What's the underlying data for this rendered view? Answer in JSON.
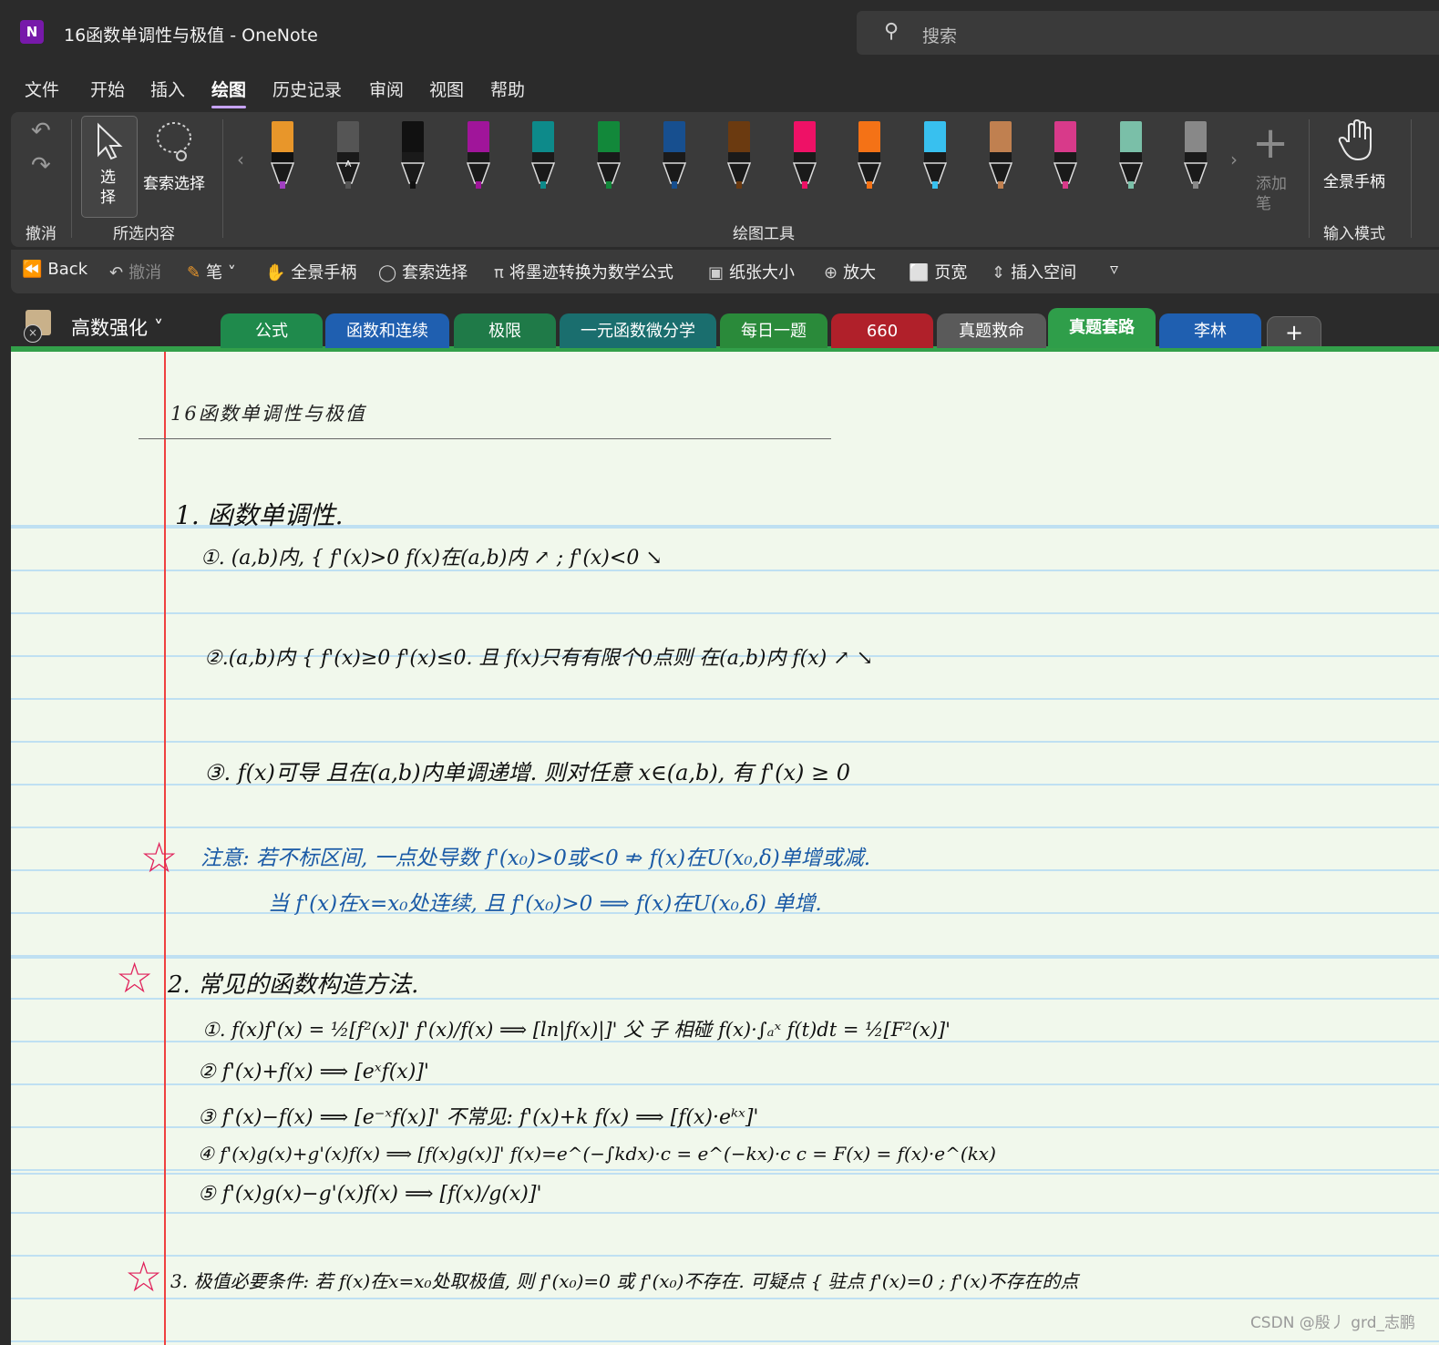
{
  "window": {
    "app_icon_letter": "N",
    "title": "16函数单调性与极值  -  OneNote",
    "search_placeholder": "搜索"
  },
  "menu": [
    "文件",
    "开始",
    "插入",
    "绘图",
    "历史记录",
    "审阅",
    "视图",
    "帮助"
  ],
  "menu_active": "绘图",
  "ribbon": {
    "undo_group_label": "撤消",
    "select_label": "选择",
    "lasso_label": "套索选择",
    "selection_group_label": "所选内容",
    "drawing_tools_label": "绘图工具",
    "add_pen_label": "添加笔",
    "hand_label": "全景手柄",
    "input_mode_label": "输入模式",
    "pens": [
      {
        "color": "#e8962a",
        "cap": "#a040c0"
      },
      {
        "color": "#555555",
        "cap": "#ffffff",
        "letter": "A"
      },
      {
        "color": "#111111",
        "cap": "#111111"
      },
      {
        "color": "#a0159a",
        "cap": "#111111"
      },
      {
        "color": "#0d8a8a",
        "cap": "#111111"
      },
      {
        "color": "#12883a",
        "cap": "#111111"
      },
      {
        "color": "#174f8f",
        "cap": "#111111"
      },
      {
        "color": "#6b3a10",
        "cap": "#111111"
      },
      {
        "color": "#ee1166",
        "cap": "#111111"
      },
      {
        "color": "#f47216",
        "cap": "#111111"
      },
      {
        "color": "#38c0ef",
        "cap": "#111111"
      },
      {
        "color": "#c08050",
        "cap": "#111111"
      },
      {
        "color": "#d83a8a",
        "cap": "#111111"
      },
      {
        "color": "#7abfa8",
        "cap": "#111111"
      },
      {
        "color": "#888888",
        "cap": "#888888"
      }
    ]
  },
  "toolbar2": {
    "back": "Back",
    "undo": "撤消",
    "pen": "笔",
    "hand": "全景手柄",
    "lasso": "套索选择",
    "ink_to_math": "将墨迹转换为数学公式",
    "paper_size": "纸张大小",
    "zoom_in": "放大",
    "page_width": "页宽",
    "insert_space": "插入空间"
  },
  "notebook": {
    "name": "高数强化",
    "tabs": [
      {
        "label": "公式",
        "color": "#1f8a4c"
      },
      {
        "label": "函数和连续",
        "color": "#1f5fb0"
      },
      {
        "label": "极限",
        "color": "#1f7a48"
      },
      {
        "label": "一元函数微分学",
        "color": "#1a6e6e"
      },
      {
        "label": "每日一题",
        "color": "#2a8a3a"
      },
      {
        "label": "660",
        "color": "#b0202a"
      },
      {
        "label": "真题救命",
        "color": "#5a5a5a"
      },
      {
        "label": "真题套路",
        "color": "#2f9e4a"
      },
      {
        "label": "李林",
        "color": "#1f5fb0"
      }
    ],
    "active_tab": "真题套路",
    "add_tab": "+"
  },
  "page": {
    "title": "16函数单调性与极值",
    "lines": [
      {
        "text": "1. 函数单调性.",
        "color": "black"
      },
      {
        "text": "①. (a,b)内, { f'(x)>0  f(x)在(a,b)内 ↗ ; f'(x)<0 ↘",
        "color": "black"
      },
      {
        "text": "②.(a,b)内 { f'(x)≥0  f'(x)≤0.  且 f(x)只有有限个0点则 在(a,b)内 f(x) ↗ ↘",
        "color": "black"
      },
      {
        "text": "③. f(x)可导 且在(a,b)内单调递增. 则对任意 x∈(a,b), 有 f'(x) ≥ 0",
        "color": "black"
      },
      {
        "text": "注意: 若不标区间, 一点处导数 f'(x₀)>0或<0 ⇏ f(x)在U(x₀,δ)单增或减.",
        "color": "blue"
      },
      {
        "text": "当 f'(x)在x=x₀处连续, 且 f'(x₀)>0 ⟹ f(x)在U(x₀,δ) 单增.",
        "color": "blue"
      },
      {
        "text": "2. 常见的函数构造方法.",
        "color": "black"
      },
      {
        "text": "①. f(x)f'(x) = ½[f²(x)]'    f'(x)/f(x) ⟹ [ln|f(x)|]'    父 子 相碰  f(x)·∫ₐˣ f(t)dt = ½[F²(x)]'",
        "color": "black"
      },
      {
        "text": "② f'(x)+f(x) ⟹ [eˣf(x)]'",
        "color": "black"
      },
      {
        "text": "③ f'(x)−f(x) ⟹ [e⁻ˣf(x)]'        不常见: f'(x)+k f(x) ⟹ [f(x)·eᵏˣ]'",
        "color": "black"
      },
      {
        "text": "④ f'(x)g(x)+g'(x)f(x) ⟹ [f(x)g(x)]'      f(x)=e^(−∫kdx)·c = e^(−kx)·c    c = F(x) = f(x)·e^(kx)",
        "color": "black"
      },
      {
        "text": "⑤ f'(x)g(x)−g'(x)f(x) ⟹ [f(x)/g(x)]'",
        "color": "black"
      },
      {
        "text": "3. 极值必要条件: 若 f(x)在x=x₀处取极值, 则 f'(x₀)=0 或 f'(x₀)不存在.     可疑点 { 驻点 f'(x)=0 ; f'(x)不存在的点",
        "color": "black"
      }
    ],
    "watermark": "CSDN @殷丿 grd_志鹏"
  }
}
